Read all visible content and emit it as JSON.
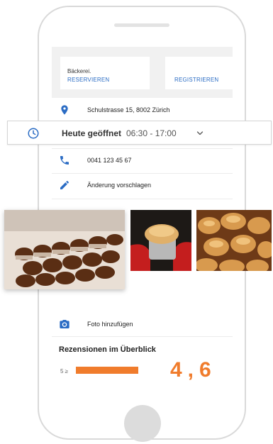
{
  "header": {
    "business_type": "Bäckerei.",
    "reserve_label": "RESERVIEREN",
    "register_label": "REGISTRIEREN"
  },
  "info": {
    "address": "Schulstrasse 15, 8002 Zürich",
    "hours_status": "Heute geöffnet",
    "hours_time": "06:30 - 17:00",
    "phone": "0041 123 45 67",
    "suggest_edit": "Änderung vorschlagen"
  },
  "photos": {
    "add_photo": "Foto hinzufügen"
  },
  "reviews": {
    "title": "Rezensionen im Überblick",
    "star_label": "5 ≥",
    "rating_partial": "4,6"
  },
  "colors": {
    "accent_blue": "#2b6cc4",
    "rating_orange": "#f07c2c"
  }
}
